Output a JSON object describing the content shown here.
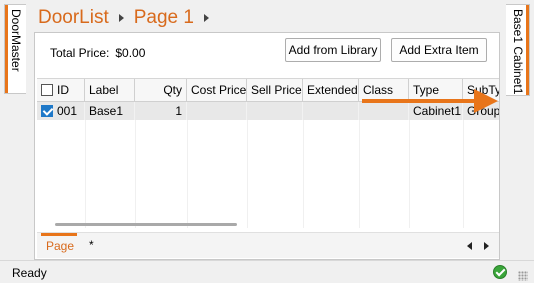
{
  "left_tab": {
    "label": "DoorMaster"
  },
  "right_tab": {
    "label": "Base1 Cabinet1"
  },
  "breadcrumb": {
    "items": [
      "DoorList",
      "Page 1"
    ]
  },
  "summary": {
    "total_price_label": "Total Price:",
    "total_price_value": "$0.00"
  },
  "toolbar": {
    "add_library_label": "Add from Library",
    "add_extra_label": "Add Extra Item"
  },
  "grid": {
    "columns": [
      "ID",
      "Label",
      "Qty",
      "Cost Price",
      "Sell Price",
      "Extended",
      "Class",
      "Type",
      "SubTy"
    ],
    "rows": [
      {
        "checked": true,
        "id": "001",
        "label": "Base1",
        "qty": "1",
        "cost_price": "",
        "sell_price": "",
        "extended": "",
        "class": "",
        "type": "Cabinet1",
        "subtype": "Group"
      }
    ]
  },
  "page_tabs": {
    "active": "Page 1",
    "add": "*"
  },
  "status": {
    "text": "Ready"
  },
  "colors": {
    "accent": "#e8751a",
    "title": "#d86a1c",
    "checkbox": "#1e78c8",
    "ok": "#3aa63a"
  },
  "icons": [
    "checkbox-icon",
    "scroll-left-icon",
    "scroll-right-icon",
    "ok-status-icon",
    "resize-grip-icon",
    "annotation-arrow-icon"
  ]
}
